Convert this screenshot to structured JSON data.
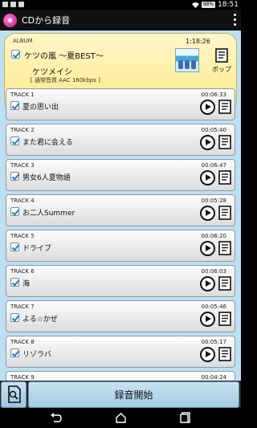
{
  "status_bar": {
    "battery": "98%",
    "time": "18:51"
  },
  "app": {
    "title": "CDから録音"
  },
  "album": {
    "label": "ALBUM",
    "duration": "1:18:26",
    "title": "ケツの嵐 ～夏BEST～",
    "artist": "ケツメイシ",
    "format": "[ 通常音質 AAC 160kbps ]",
    "pop_label": "ポップ"
  },
  "tracks": [
    {
      "label": "TRACK 1",
      "name": "夏の思い出",
      "duration": "00:06:33"
    },
    {
      "label": "TRACK 2",
      "name": "また君に会える",
      "duration": "00:05:40"
    },
    {
      "label": "TRACK 3",
      "name": "男女6人夏物語",
      "duration": "00:06:47"
    },
    {
      "label": "TRACK 4",
      "name": "お二人Summer",
      "duration": "00:05:28"
    },
    {
      "label": "TRACK 5",
      "name": "ドライブ",
      "duration": "00:06:20"
    },
    {
      "label": "TRACK 6",
      "name": "海",
      "duration": "00:06:03"
    },
    {
      "label": "TRACK 7",
      "name": "よる☆かぜ",
      "duration": "00:05:46"
    },
    {
      "label": "TRACK 8",
      "name": "リゾラバ",
      "duration": "00:05:17"
    },
    {
      "label": "TRACK 9",
      "name": "",
      "duration": "00:04:24"
    }
  ],
  "bottom": {
    "record_label": "録音開始"
  }
}
